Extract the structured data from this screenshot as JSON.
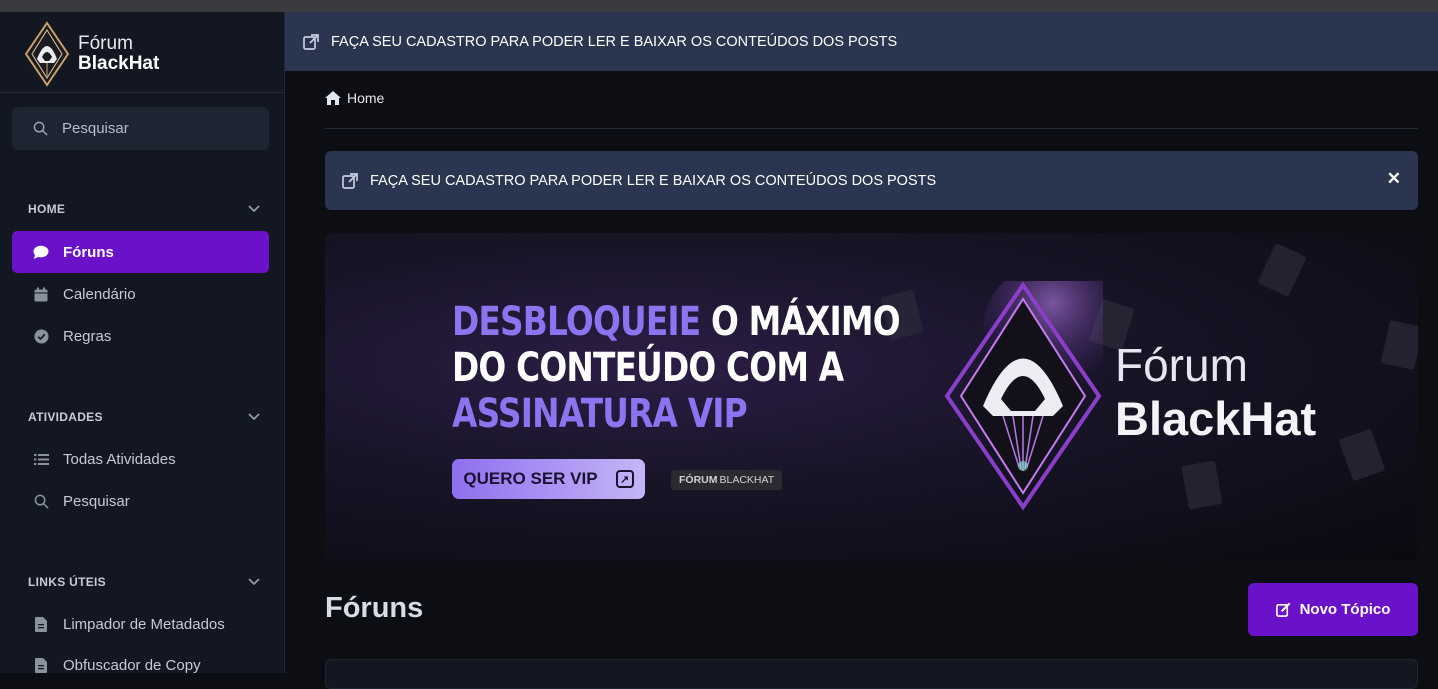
{
  "sidebar": {
    "logo": {
      "line1": "Fórum",
      "line2": "BlackHat",
      "icon": "hooded-diamond-logo"
    },
    "search_label": "Pesquisar",
    "sections": [
      {
        "title": "HOME",
        "items": [
          {
            "label": "Fóruns",
            "icon": "comment-icon",
            "active": true
          },
          {
            "label": "Calendário",
            "icon": "calendar-icon"
          },
          {
            "label": "Regras",
            "icon": "check-circle-icon"
          }
        ]
      },
      {
        "title": "ATIVIDADES",
        "items": [
          {
            "label": "Todas Atividades",
            "icon": "list-icon"
          },
          {
            "label": "Pesquisar",
            "icon": "search-icon"
          }
        ]
      },
      {
        "title": "LINKS ÚTEIS",
        "items": [
          {
            "label": "Limpador de Metadados",
            "icon": "file-icon"
          },
          {
            "label": "Obfuscador de Copy",
            "icon": "file-icon"
          }
        ]
      }
    ]
  },
  "topbar": {
    "text": "FAÇA SEU CADASTRO PARA PODER LER E BAIXAR OS CONTEÚDOS DOS POSTS",
    "icon": "external-link-icon"
  },
  "breadcrumb": {
    "home": "Home"
  },
  "notice": {
    "text": "FAÇA SEU CADASTRO PARA PODER LER E BAIXAR OS CONTEÚDOS DOS POSTS",
    "close": "✕"
  },
  "banner": {
    "headline_hl1": "DESBLOQUEIE",
    "headline_rest1": " O MÁXIMO",
    "headline_line2": "DO CONTEÚDO COM A",
    "headline_hl3": "ASSINATURA VIP",
    "button": "QUERO SER VIP",
    "tag_bold": "FÓRUM",
    "tag_rest": "BLACKHAT",
    "logo_line1": "Fórum",
    "logo_line2": "BlackHat"
  },
  "page": {
    "title": "Fóruns",
    "new_topic": "Novo Tópico"
  },
  "colors": {
    "accent": "#6a12c9",
    "sidebar_bg": "#131722",
    "notice_bg": "#2a3550",
    "highlight": "#8c73f0"
  }
}
